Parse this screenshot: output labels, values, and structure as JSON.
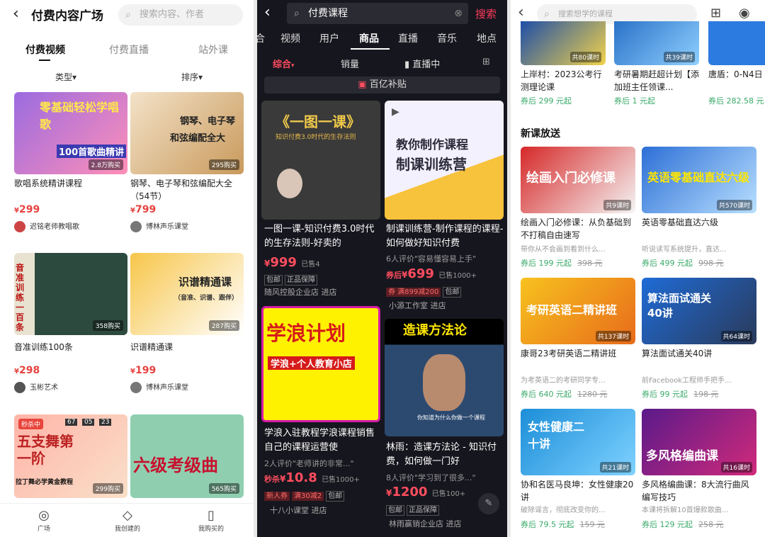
{
  "p1": {
    "back": "‹",
    "title": "付费内容广场",
    "search_placeholder": "搜索内容、作者",
    "tabs": [
      "付费视频",
      "付费直播",
      "站外课"
    ],
    "filters": {
      "type": "类型",
      "sort": "排序"
    },
    "cards": [
      {
        "title": "歌唱系统精讲课程",
        "price": "299",
        "author": "迟铭老师教唱歌",
        "count": "2.8万购买",
        "banner": "零基础轻松学唱歌",
        "sub": "100首歌曲精讲"
      },
      {
        "title": "钢琴、电子琴和弦编配大全（54节）",
        "price": "799",
        "author": "博林声乐课堂",
        "count": "295购买",
        "banner": "钢琴、电子琴",
        "sub": "和弦编配全大"
      },
      {
        "title": "音准训练100条",
        "price": "298",
        "author": "玉彬艺术",
        "count": "358购买",
        "banner": "音准训练一百条",
        "sub": ""
      },
      {
        "title": "识谱精通课",
        "price": "199",
        "author": "博林声乐课堂",
        "count": "287购买",
        "banner": "识谱精通课",
        "sub": "（音准、识谱、跟伴）"
      },
      {
        "title": "",
        "price": "",
        "author": "",
        "count": "299购买",
        "banner": "五支舞第一阶",
        "sub": "拉丁舞必学黄金教程",
        "flash": "秒杀中",
        "timer": [
          "67",
          "05",
          "23"
        ]
      },
      {
        "title": "",
        "price": "",
        "author": "",
        "count": "565购买",
        "banner": "六级考级曲",
        "sub": ""
      }
    ],
    "nav": [
      {
        "icon": "compass-icon",
        "glyph": "◎",
        "label": "广场"
      },
      {
        "icon": "diamond-icon",
        "glyph": "◇",
        "label": "我创建的"
      },
      {
        "icon": "bookmark-icon",
        "glyph": "▯",
        "label": "我购买的"
      }
    ]
  },
  "p2": {
    "back": "‹",
    "query": "付费课程",
    "search_btn": "搜索",
    "categories": [
      "合",
      "视频",
      "用户",
      "商品",
      "直播",
      "音乐",
      "地点"
    ],
    "subtabs": [
      "综合",
      "销量",
      "直播中"
    ],
    "banner": "百亿补贴",
    "cards": [
      {
        "title": "一图一课-知识付费3.0时代的生存法则-好卖的",
        "price": "999",
        "sold": "已售4",
        "tags": [
          "包邮",
          "正品保障"
        ],
        "shop": "随风控股企业店 进店",
        "img": "《一图一课》",
        "imgsub": "知识付费3.0时代的生存法则",
        "promo": []
      },
      {
        "title": "制课训练营-制作课程的课程-如何做好知识付费",
        "price": "699",
        "sold": "已售1000+",
        "tags": [
          "包邮"
        ],
        "shop": "小源工作室 进店",
        "img": "教你制作课程",
        "imgsub": "制课训练营",
        "review": "6人评价\"容易懂容易上手\"",
        "pricepre": "券后",
        "promo": [
          "券 满899减200"
        ]
      },
      {
        "title": "学浪入驻教程学浪课程销售自己的课程运营使",
        "price": "10.8",
        "sold": "已售1000+",
        "tags": [
          "包邮"
        ],
        "shop": "十八小课堂 进店",
        "img": "学浪计划",
        "imgsub": "学浪+个人教育小店",
        "review": "2人评价\"老师讲的非常...\"",
        "pricepre": "秒杀",
        "promo": [
          "新人券",
          "满30减2"
        ]
      },
      {
        "title": "林雨：造课方法论 - 知识付费，如何做一门好",
        "price": "1200",
        "sold": "已售100+",
        "tags": [
          "包邮",
          "正品保障"
        ],
        "shop": "林雨赢销企业店 进店",
        "img": "造课方法论",
        "imgsub": "你知道为什么你做一个课程",
        "review": "8人评价\"学习到了很多...\"",
        "pricepre": "",
        "promo": []
      }
    ]
  },
  "p3": {
    "back": "‹",
    "search_placeholder": "搜索想学的课程",
    "top": [
      {
        "title": "上岸村：2023公考行测理论课",
        "coupon": "券后 299 元起",
        "count": "共80课时"
      },
      {
        "title": "考研暑期赶超计划【添加班主任领课...",
        "coupon": "券后 1 元起",
        "count": "共39课时"
      },
      {
        "title": "唐盾：0-N4日",
        "coupon": "券后 282.58 元",
        "count": ""
      }
    ],
    "section": "新课放送",
    "cards": [
      {
        "title": "绘画入门必修课：从负基础到不打稿自由速写",
        "desc": "带你从不会画到看到什么...",
        "coupon": "券后 199 元起",
        "orig": "398 元",
        "count": "共9课时",
        "img": "绘画入门必修课"
      },
      {
        "title": "英语零基础直达六级",
        "desc": "听说读写系统提升，直达...",
        "coupon": "券后 499 元起",
        "orig": "998 元",
        "count": "共570课时",
        "img": "英语零基础直达六级"
      },
      {
        "title": "康哥23考研英语二精讲班",
        "desc": "为考英语二的考研同学专...",
        "coupon": "券后 640 元起",
        "orig": "1280 元",
        "count": "共137课时",
        "img": "考研英语二精讲班"
      },
      {
        "title": "算法面试通关40讲",
        "desc": "前Facebook工程师手把手...",
        "coupon": "券后 99 元起",
        "orig": "198 元",
        "count": "共64课时",
        "img": "算法面试通关40讲"
      },
      {
        "title": "协和名医马良坤：女性健康20讲",
        "desc": "破除谣言，彻底改变你的...",
        "coupon": "券后 79.5 元起",
        "orig": "159 元",
        "count": "共21课时",
        "img": "女性健康二十讲"
      },
      {
        "title": "多风格编曲课：8大流行曲风编写技巧",
        "desc": "本课将拆解10首爆款歌曲...",
        "coupon": "券后 129 元起",
        "orig": "258 元",
        "count": "共16课时",
        "img": "多风格编曲课"
      }
    ]
  }
}
